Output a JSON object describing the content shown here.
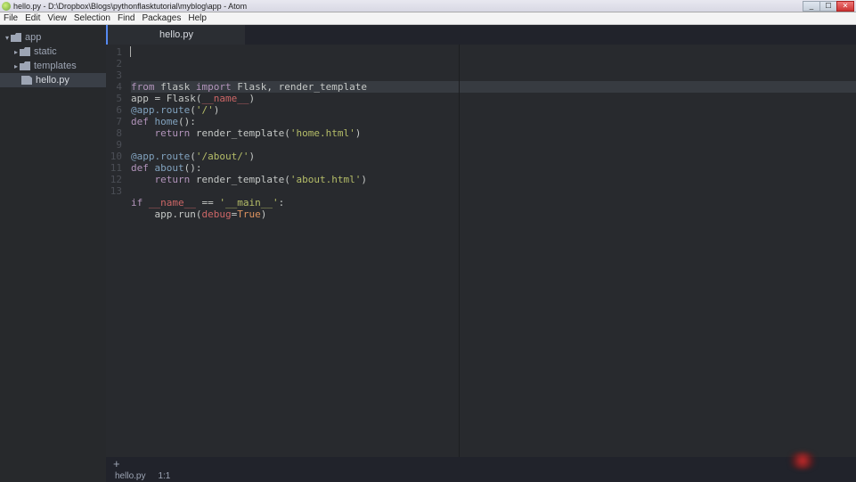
{
  "window": {
    "title": "hello.py - D:\\Dropbox\\Blogs\\pythonflasktutorial\\myblog\\app - Atom"
  },
  "menu": {
    "items": [
      "File",
      "Edit",
      "View",
      "Selection",
      "Find",
      "Packages",
      "Help"
    ]
  },
  "tree": {
    "root": "app",
    "folders": [
      "static",
      "templates"
    ],
    "files": [
      "hello.py"
    ],
    "selected": "hello.py"
  },
  "tab": {
    "label": "hello.py"
  },
  "statusbar": {
    "file": "hello.py",
    "position": "1:1"
  },
  "addtab_icon": "+",
  "win_controls": {
    "min": "_",
    "max": "☐",
    "close": "✕"
  },
  "code": {
    "lines": [
      {
        "n": 1,
        "hl": true,
        "tokens": [
          [
            "kw",
            "from"
          ],
          [
            "op",
            " flask "
          ],
          [
            "kw",
            "import"
          ],
          [
            "op",
            " Flask"
          ],
          [
            "op",
            ", render_template"
          ]
        ]
      },
      {
        "n": 2,
        "tokens": [
          [
            "op",
            "app "
          ],
          [
            "op",
            "="
          ],
          [
            "op",
            " Flask("
          ],
          [
            "name",
            "__name__"
          ],
          [
            "op",
            ")"
          ]
        ]
      },
      {
        "n": 3,
        "tokens": [
          [
            "dec",
            "@app.route"
          ],
          [
            "op",
            "("
          ],
          [
            "str",
            "'/'"
          ],
          [
            "op",
            ")"
          ]
        ]
      },
      {
        "n": 4,
        "tokens": [
          [
            "kw",
            "def "
          ],
          [
            "fn",
            "home"
          ],
          [
            "op",
            "():"
          ]
        ]
      },
      {
        "n": 5,
        "tokens": [
          [
            "op",
            "    "
          ],
          [
            "kw",
            "return"
          ],
          [
            "op",
            " render_template("
          ],
          [
            "str",
            "'home.html'"
          ],
          [
            "op",
            ")"
          ]
        ]
      },
      {
        "n": 6,
        "tokens": []
      },
      {
        "n": 7,
        "tokens": [
          [
            "dec",
            "@app.route"
          ],
          [
            "op",
            "("
          ],
          [
            "str",
            "'/about/'"
          ],
          [
            "op",
            ")"
          ]
        ]
      },
      {
        "n": 8,
        "tokens": [
          [
            "kw",
            "def "
          ],
          [
            "fn",
            "about"
          ],
          [
            "op",
            "():"
          ]
        ]
      },
      {
        "n": 9,
        "tokens": [
          [
            "op",
            "    "
          ],
          [
            "kw",
            "return"
          ],
          [
            "op",
            " render_template("
          ],
          [
            "str",
            "'about.html'"
          ],
          [
            "op",
            ")"
          ]
        ]
      },
      {
        "n": 10,
        "tokens": []
      },
      {
        "n": 11,
        "tokens": [
          [
            "kw",
            "if"
          ],
          [
            "op",
            " "
          ],
          [
            "name",
            "__name__"
          ],
          [
            "op",
            " "
          ],
          [
            "op",
            "=="
          ],
          [
            "op",
            " "
          ],
          [
            "str",
            "'__main__'"
          ],
          [
            "op",
            ":"
          ]
        ]
      },
      {
        "n": 12,
        "tokens": [
          [
            "op",
            "    app.run("
          ],
          [
            "name",
            "debug"
          ],
          [
            "op",
            "="
          ],
          [
            "const",
            "True"
          ],
          [
            "op",
            ")"
          ]
        ]
      },
      {
        "n": 13,
        "tokens": []
      }
    ]
  }
}
